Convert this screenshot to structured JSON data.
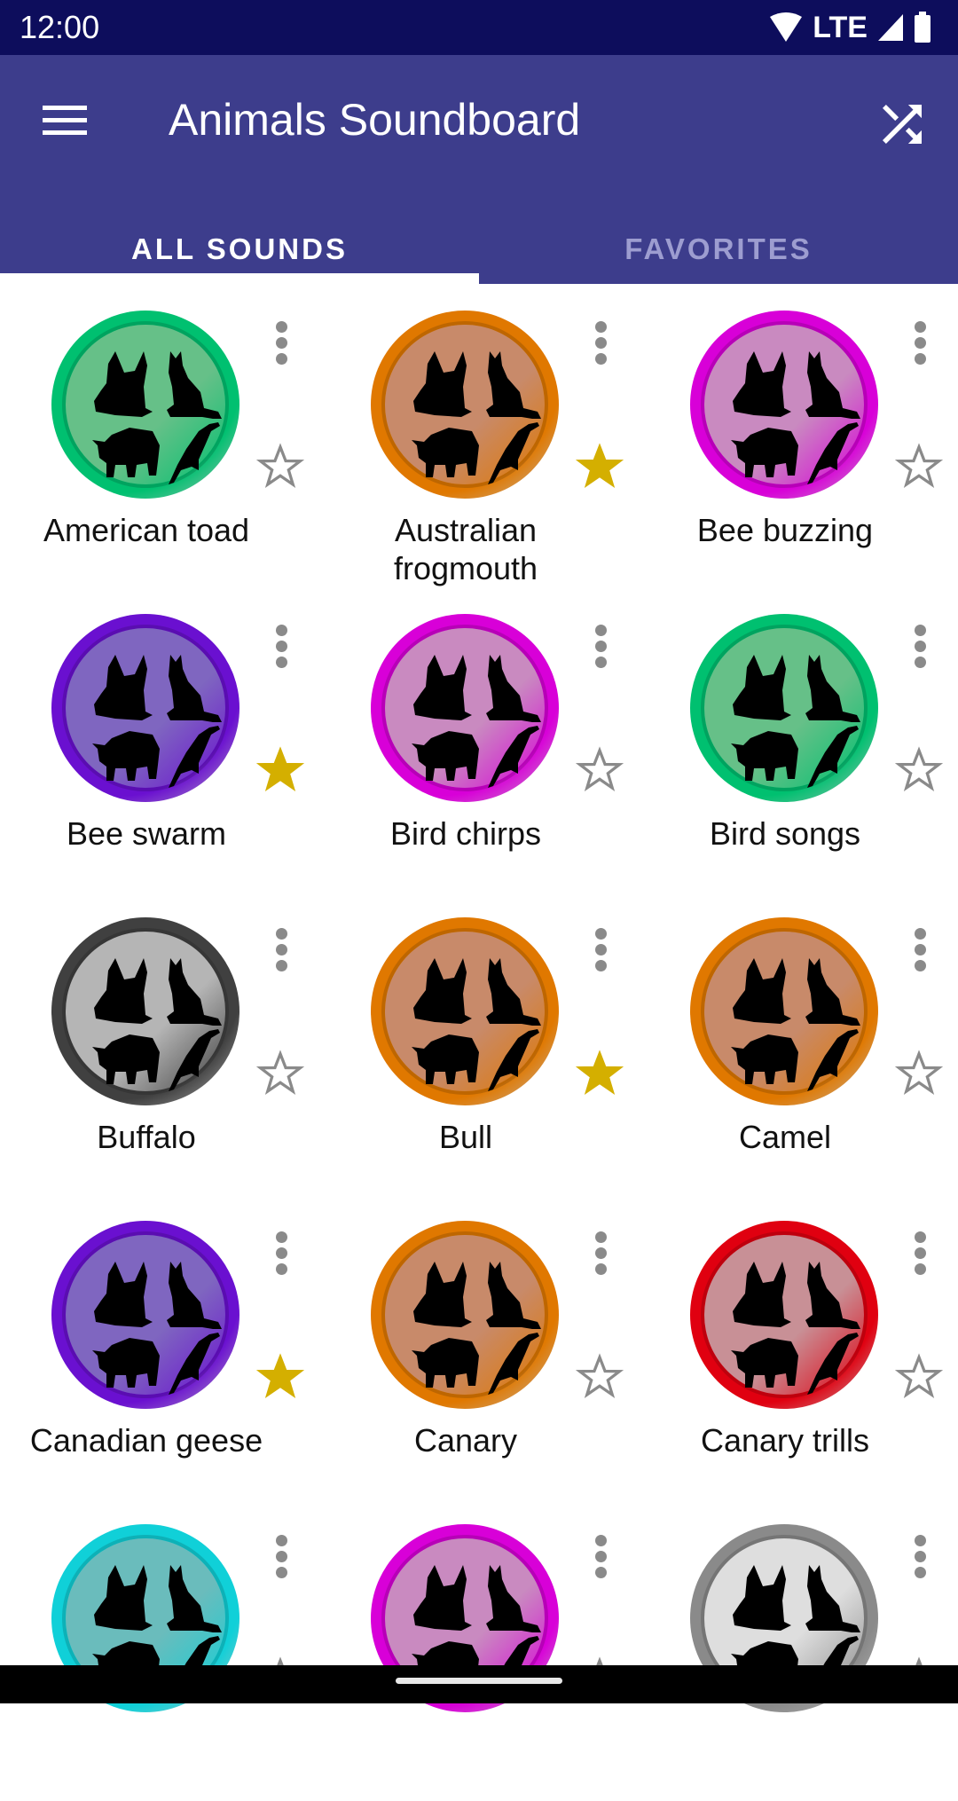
{
  "status_bar": {
    "time": "12:00",
    "network": "LTE"
  },
  "app_bar": {
    "title": "Animals Soundboard",
    "menu_icon": "hamburger-menu-icon",
    "shuffle_icon": "shuffle-icon"
  },
  "tabs": [
    {
      "label": "ALL SOUNDS",
      "active": true
    },
    {
      "label": "FAVORITES",
      "active": false
    }
  ],
  "colors": {
    "status_bar": "#0d0d5c",
    "app_bar": "#3d3d8c",
    "star_favorite": "#d4af00",
    "star_empty": "#8a8a8a"
  },
  "sounds": [
    {
      "name": "American toad",
      "color": "green",
      "favorite": false
    },
    {
      "name": "Australian frogmouth",
      "color": "orange",
      "favorite": true
    },
    {
      "name": "Bee buzzing",
      "color": "magenta",
      "favorite": false
    },
    {
      "name": "Bee swarm",
      "color": "purple",
      "favorite": true
    },
    {
      "name": "Bird chirps",
      "color": "magenta",
      "favorite": false
    },
    {
      "name": "Bird songs",
      "color": "green",
      "favorite": false
    },
    {
      "name": "Buffalo",
      "color": "dark-gray",
      "favorite": false
    },
    {
      "name": "Bull",
      "color": "orange",
      "favorite": true
    },
    {
      "name": "Camel",
      "color": "orange",
      "favorite": false
    },
    {
      "name": "Canadian geese",
      "color": "purple",
      "favorite": true
    },
    {
      "name": "Canary",
      "color": "orange",
      "favorite": false
    },
    {
      "name": "Canary trills",
      "color": "red",
      "favorite": false
    },
    {
      "name": "",
      "color": "cyan",
      "favorite": false
    },
    {
      "name": "",
      "color": "magenta",
      "favorite": false
    },
    {
      "name": "",
      "color": "light-gray",
      "favorite": false
    }
  ],
  "palette": {
    "green": [
      "#00c070",
      "#66c088"
    ],
    "orange": [
      "#e07800",
      "#c88a6a"
    ],
    "magenta": [
      "#d800d8",
      "#c98ac0"
    ],
    "purple": [
      "#6a10d0",
      "#7f66c0"
    ],
    "dark-gray": [
      "#404040",
      "#b5b5b5"
    ],
    "red": [
      "#e00010",
      "#c89096"
    ],
    "cyan": [
      "#10d0d8",
      "#6abcbc"
    ],
    "light-gray": [
      "#8a8a8a",
      "#dedede"
    ]
  }
}
